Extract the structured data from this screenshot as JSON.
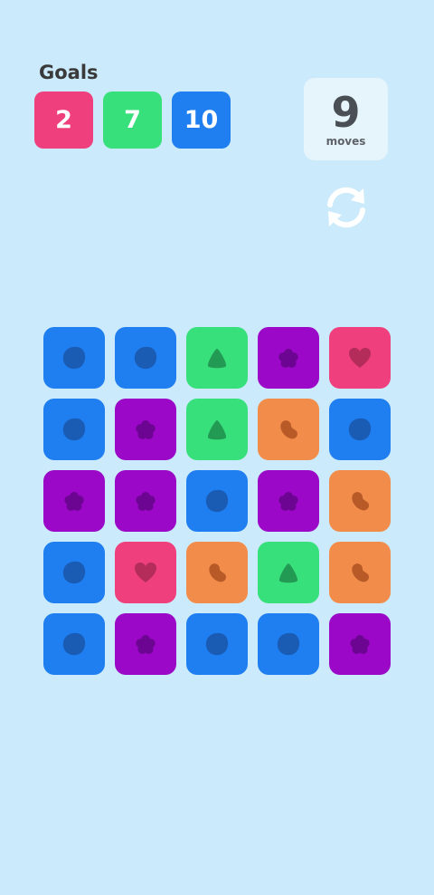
{
  "goals": {
    "title": "Goals",
    "items": [
      {
        "value": "2",
        "color": "#ef3f7c"
      },
      {
        "value": "7",
        "color": "#38e07c"
      },
      {
        "value": "10",
        "color": "#1f7ef0"
      }
    ]
  },
  "moves": {
    "value": "9",
    "label": "moves"
  },
  "refresh_icon": "refresh-icon",
  "tile_types": {
    "blue": {
      "color": "#1f7ef0",
      "shape": "circle",
      "shape_color": "#1a5bb3"
    },
    "green": {
      "color": "#38e07c",
      "shape": "triangle",
      "shape_color": "#239a53"
    },
    "purple": {
      "color": "#9b08c7",
      "shape": "flower",
      "shape_color": "#6c0592"
    },
    "pink": {
      "color": "#ef3f7c",
      "shape": "heart",
      "shape_color": "#b32c5a"
    },
    "orange": {
      "color": "#f28c4a",
      "shape": "bean",
      "shape_color": "#b85a28"
    }
  },
  "board": [
    [
      "blue",
      "blue",
      "green",
      "purple",
      "pink"
    ],
    [
      "blue",
      "purple",
      "green",
      "orange",
      "blue"
    ],
    [
      "purple",
      "purple",
      "blue",
      "purple",
      "orange"
    ],
    [
      "blue",
      "pink",
      "orange",
      "green",
      "orange"
    ],
    [
      "blue",
      "purple",
      "blue",
      "blue",
      "purple"
    ]
  ]
}
